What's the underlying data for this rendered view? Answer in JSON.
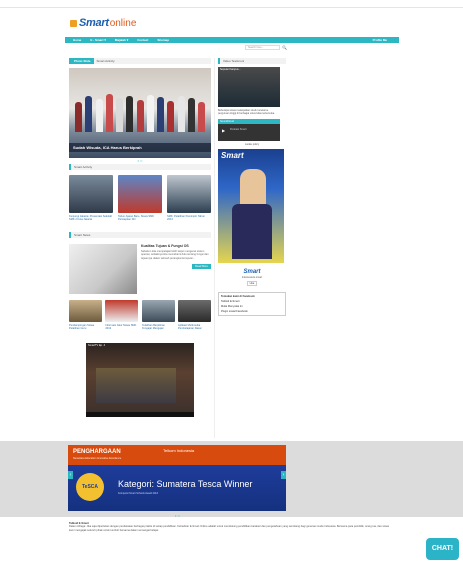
{
  "brand": {
    "smart": "Smart",
    "online": "online"
  },
  "nav": {
    "items": [
      "Home",
      "E - Smart ▾",
      "Majalah ▾",
      "Contact",
      "Sitemap"
    ],
    "login": "Profile Me"
  },
  "search": {
    "placeholder": "Search here...",
    "button": "🔍"
  },
  "slider": {
    "tabs": [
      "Photo Slide",
      "Smart Activity"
    ],
    "caption": "Sudah Wisuda, ICA Harus Berkiprah",
    "dots": "• ○"
  },
  "activity": {
    "title": "Smart Activity",
    "items": [
      "Kunjungi Jakarta: Presentasi Sekolah SMK 2 Kota Jakarta",
      "Tahun Ajaran Baru, Siswa SMK Persiapkan Diri",
      "SMK: Pelatihan Pemimpin Tahun 2013",
      "Penyerahan Hadiah Lomba"
    ]
  },
  "news": {
    "title": "Smart News",
    "featured_title": "Kualitas Tujuan & Fungsi OS",
    "featured_excerpt": "Sebelum kita mempelajari lebih lanjut mengenai sistem operasi, sebaiknya kita memahami dulu tentang fungsi dan tujuannya dalam sebuah perangkat komputer...",
    "readmore": "Read More",
    "small": [
      "Pendampingan Siswa Pelatihan Guru",
      "Informasi Jalur Siswa SMK 2013",
      "Pelatihan Berpikiran Pengajar Mengajar",
      "Aplikasi Multimedia Pembelajaran Dasar"
    ]
  },
  "video": {
    "title": "SmartTV Ep. 4"
  },
  "sidebar": {
    "video_title": "Video Testimoni",
    "video_overlay": "Seputar Kampus...",
    "video_caption": "Beberapa siswa melanjutkan studi mereka ke perguruan tinggi di berbagai universitas terkemuka.",
    "sound_header": "SoundCloud",
    "sound_title": "Podcast Smart",
    "sound_caption": "cookie policy",
    "magazine": "Smart",
    "fan_logo": "Smart",
    "fan_text": "Indonesia E-smart",
    "like": "Like",
    "fb_title": "Temukan kami di Facebook",
    "fb_row1": "Tabloid E-Smart",
    "fb_row2": "Mulai Menyukai Ini",
    "fb_row3": "Plugin sosial Facebook"
  },
  "tesca": {
    "penghargaan": "PENGHARGAAN",
    "telkom": "Telkom Indonesia",
    "sub": "Nusantara Education Innovative Excellence",
    "badge": "TeSCA",
    "kategori": "Kategori: Sumatera Tesca Winner",
    "kategori_sub": "Kompetisi Smart Schools Award 2013",
    "dots": "• ○"
  },
  "about": {
    "title": "Tabloid E-Smart",
    "text": "Dalam Ahlaga: Jika saja diperlukan dengan pendekatan berbagai praktis di setiap pendidikan. Kehadiran E-Smart Online adalah untuk mendukung pendidikan karakter dan pengetahuan yang seimbang bagi generasi muda Indonesia. Bersama para pendidik, orang tua, dan siswa kami mengajak seluruh pihak untuk tumbuh bersama dalam semangat belajar."
  },
  "chat": {
    "label": "CHAT!"
  },
  "colors": {
    "accent": "#2cb7c2",
    "brand_blue": "#1b5fb0",
    "brand_orange": "#e05a1c"
  }
}
